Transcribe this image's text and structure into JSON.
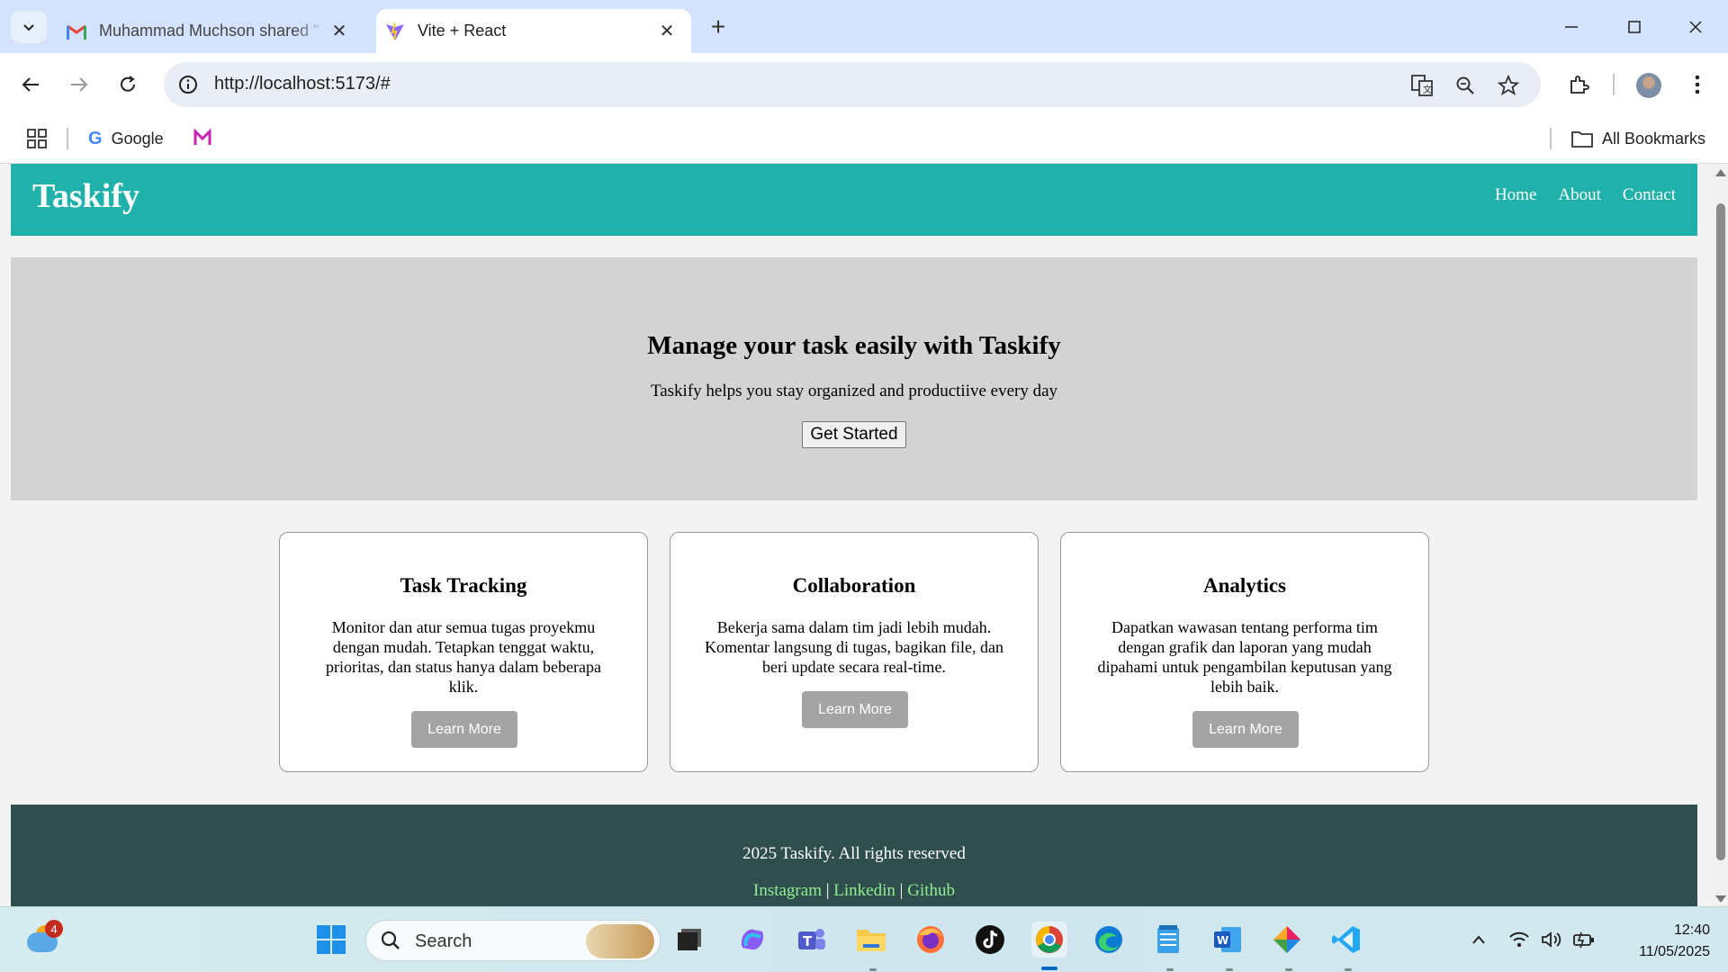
{
  "browser": {
    "tabs": [
      {
        "title": "Muhammad Muchson shared \"",
        "icon": "gmail-icon",
        "active": false
      },
      {
        "title": "Vite + React",
        "icon": "vite-icon",
        "active": true
      }
    ],
    "url": "http://localhost:5173/#",
    "bookmarks": {
      "google_label": "Google",
      "all_bookmarks_label": "All Bookmarks"
    }
  },
  "site": {
    "logo": "Taskify",
    "nav": [
      "Home",
      "About",
      "Contact"
    ],
    "hero": {
      "title": "Manage your task easily with Taskify",
      "subtitle": "Taskify helps you stay organized and productiive every day",
      "button": "Get Started"
    },
    "features": [
      {
        "title": "Task Tracking",
        "text": "Monitor dan atur semua tugas proyekmu dengan mudah. Tetapkan tenggat waktu, prioritas, dan status hanya dalam beberapa klik.",
        "button": "Learn More"
      },
      {
        "title": "Collaboration",
        "text": "Bekerja sama dalam tim jadi lebih mudah. Komentar langsung di tugas, bagikan file, dan beri update secara real-time.",
        "button": "Learn More"
      },
      {
        "title": "Analytics",
        "text": "Dapatkan wawasan tentang performa tim dengan grafik dan laporan yang mudah dipahami untuk pengambilan keputusan yang lebih baik.",
        "button": "Learn More"
      }
    ],
    "footer": {
      "copyright": "2025 Taskify. All rights reserved",
      "links": [
        "Instagram",
        "Linkedin",
        "Github"
      ],
      "separator": "|"
    },
    "colors": {
      "header": "#20b2aa",
      "hero": "#d3d3d3",
      "footer": "#2f4f4f",
      "footer_link": "#90ee90",
      "learn_button": "#a4a4a4"
    }
  },
  "taskbar": {
    "weather_badge": "4",
    "search_placeholder": "Search",
    "time": "12:40",
    "date": "11/05/2025"
  }
}
